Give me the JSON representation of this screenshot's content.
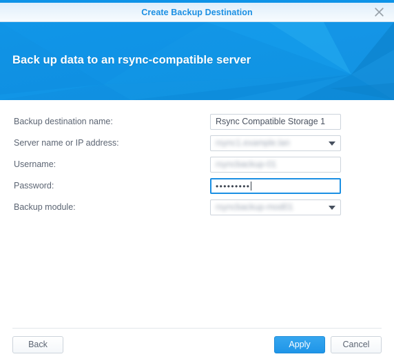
{
  "window": {
    "title": "Create Backup Destination",
    "close_icon": "close-icon"
  },
  "banner": {
    "heading": "Back up data to an rsync-compatible server",
    "accent_color": "#0e93e4"
  },
  "form": {
    "fields": [
      {
        "label": "Backup destination name:",
        "type": "text",
        "value": "Rsync Compatible Storage 1",
        "redacted": false,
        "focused": false
      },
      {
        "label": "Server name or IP address:",
        "type": "select",
        "value": "rsync1.example.lan",
        "redacted": true,
        "focused": false
      },
      {
        "label": "Username:",
        "type": "text",
        "value": "rsyncbackup-01",
        "redacted": true,
        "focused": false
      },
      {
        "label": "Password:",
        "type": "password",
        "value": "•••••••••",
        "redacted": false,
        "focused": true
      },
      {
        "label": "Backup module:",
        "type": "select",
        "value": "rsyncbackup-mod01",
        "redacted": true,
        "focused": false
      }
    ]
  },
  "footer": {
    "back_label": "Back",
    "apply_label": "Apply",
    "cancel_label": "Cancel",
    "primary_color": "#1f95e8"
  }
}
